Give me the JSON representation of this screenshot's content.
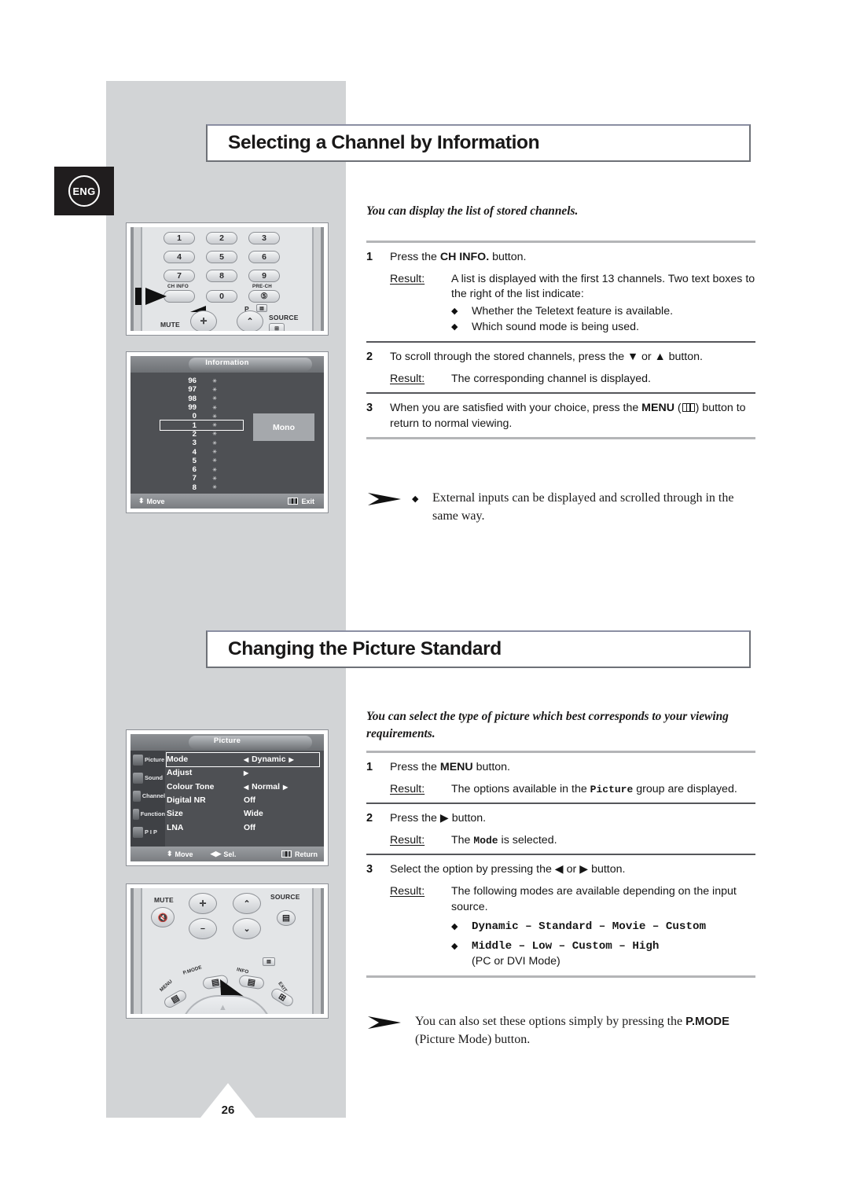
{
  "page": {
    "number": "26",
    "language_badge": "ENG"
  },
  "sections": [
    {
      "title": "Selecting a Channel by Information",
      "intro": "You can display the list of stored channels.",
      "steps": [
        {
          "num": "1",
          "text_before": "Press the ",
          "text_bold": "CH INFO.",
          "text_after": " button.",
          "result_label": "Result:",
          "result_text": "A list is displayed with the first 13 channels. Two text boxes to the right of the list indicate:",
          "bullets": [
            "Whether the Teletext feature is available.",
            "Which sound mode is being used."
          ]
        },
        {
          "num": "2",
          "text_before": "To scroll through the stored channels, press the ",
          "text_bold": "▼ or ▲",
          "text_after": " button.",
          "result_label": "Result:",
          "result_text": "The corresponding channel is displayed.",
          "bullets": []
        },
        {
          "num": "3",
          "text_before": "When you are satisfied with your choice, press the ",
          "text_bold": "MENU",
          "text_after": " button to return to normal viewing.",
          "result_label": "",
          "result_text": "",
          "bullets": []
        }
      ],
      "note": {
        "bullet": "◆",
        "text": "External inputs can be displayed and scrolled through in the same way."
      }
    },
    {
      "title": "Changing the Picture Standard",
      "intro": "You can select the type of picture which best corresponds to your viewing requirements.",
      "steps": [
        {
          "num": "1",
          "text_before": "Press the ",
          "text_bold": "MENU",
          "text_after": " button.",
          "result_label": "Result:",
          "result_text_pre": "The options available in the ",
          "result_mono": "Picture",
          "result_text_post": " group are displayed."
        },
        {
          "num": "2",
          "text_before": "Press the ",
          "text_bold": "▶",
          "text_after": " button.",
          "result_label": "Result:",
          "result_text_pre": "The ",
          "result_mono": "Mode",
          "result_text_post": " is selected."
        },
        {
          "num": "3",
          "text_before": "Select the option by pressing the ",
          "text_bold": "◀ or ▶",
          "text_after": " button.",
          "result_label": "Result:",
          "result_text": "The following modes are available depending on the input source.",
          "mode_bullets": [
            "Dynamic – Standard – Movie – Custom",
            "Middle – Low – Custom – High"
          ],
          "mode_note": "(PC or DVI Mode)"
        }
      ],
      "note": {
        "text_pre": "You can also set these options simply by pressing the ",
        "text_bold": "P.MODE",
        "text_post": " (Picture Mode) button."
      }
    }
  ],
  "illustrations": {
    "remote_top": {
      "keys": [
        "1",
        "2",
        "3",
        "4",
        "5",
        "6",
        "7",
        "8",
        "9",
        "0"
      ],
      "labels": {
        "ch_info": "CH INFO",
        "pre_ch": "PRE-CH",
        "mute": "MUTE",
        "source": "SOURCE",
        "p": "P"
      }
    },
    "information_osd": {
      "title": "Information",
      "channels": [
        "96",
        "97",
        "98",
        "99",
        "0",
        "1",
        "2",
        "3",
        "4",
        "5",
        "6",
        "7",
        "8"
      ],
      "selected_channel": "1",
      "star": "✳",
      "sound_box": "Mono",
      "footer_move": "Move",
      "footer_exit": "Exit"
    },
    "picture_osd": {
      "title": "Picture",
      "sidebar": [
        "Picture",
        "Sound",
        "Channel",
        "Function",
        "P I P"
      ],
      "rows": [
        {
          "label": "Mode",
          "value": "Dynamic",
          "arrows": "both",
          "selected": true
        },
        {
          "label": "Adjust",
          "value": "",
          "arrows": "right",
          "selected": false
        },
        {
          "label": "Colour Tone",
          "value": "Normal",
          "arrows": "both",
          "selected": false
        },
        {
          "label": "Digital NR",
          "value": "Off",
          "arrows": "none",
          "selected": false
        },
        {
          "label": "Size",
          "value": "Wide",
          "arrows": "none",
          "selected": false
        },
        {
          "label": "LNA",
          "value": "Off",
          "arrows": "none",
          "selected": false
        }
      ],
      "footer_move": "Move",
      "footer_sel": "Sel.",
      "footer_return": "Return"
    },
    "remote_bottom": {
      "labels": {
        "mute": "MUTE",
        "source": "SOURCE",
        "menu": "MENU",
        "p_mode": "P.MODE",
        "info": "INFO",
        "exit": "EXIT"
      }
    }
  },
  "colors": {
    "gray_column": "#d2d4d6",
    "title_border": "#6e7177",
    "osd_bg": "#4e5054",
    "badge_bg": "#201d1e"
  }
}
